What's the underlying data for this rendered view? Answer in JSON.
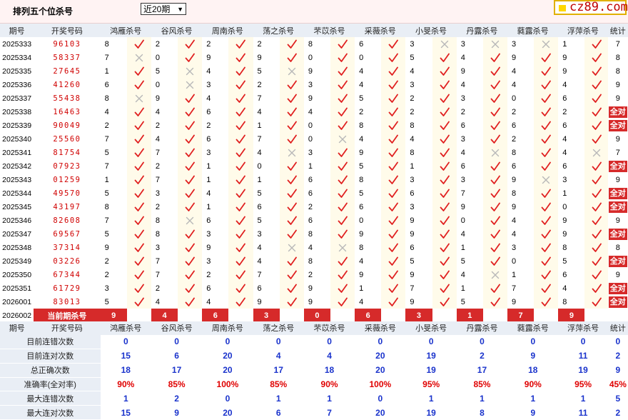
{
  "page_title": "排列五个位杀号",
  "period_select": {
    "value": "近20期"
  },
  "logo_text": "cz89.com",
  "header": {
    "period": "期号",
    "number": "开奖号码",
    "count": "统计"
  },
  "experts": [
    "鸿雁杀号",
    "谷风杀号",
    "周南杀号",
    "荡之杀号",
    "芣苡杀号",
    "采薇杀号",
    "小旻杀号",
    "丹露杀号",
    "蕤露杀号",
    "浮萍杀号"
  ],
  "all_correct_label": "全对",
  "rows": [
    {
      "period": "2025333",
      "number": "96103",
      "kills": [
        [
          8,
          1
        ],
        [
          2,
          1
        ],
        [
          2,
          1
        ],
        [
          2,
          1
        ],
        [
          8,
          1
        ],
        [
          6,
          1
        ],
        [
          3,
          0
        ],
        [
          3,
          0
        ],
        [
          3,
          0
        ],
        [
          1,
          1
        ]
      ],
      "count": "7"
    },
    {
      "period": "2025334",
      "number": "58337",
      "kills": [
        [
          7,
          0
        ],
        [
          0,
          1
        ],
        [
          9,
          1
        ],
        [
          9,
          1
        ],
        [
          0,
          1
        ],
        [
          0,
          1
        ],
        [
          5,
          1
        ],
        [
          4,
          1
        ],
        [
          9,
          1
        ],
        [
          9,
          1
        ]
      ],
      "count": "8"
    },
    {
      "period": "2025335",
      "number": "27645",
      "kills": [
        [
          1,
          1
        ],
        [
          5,
          0
        ],
        [
          4,
          1
        ],
        [
          5,
          0
        ],
        [
          9,
          1
        ],
        [
          4,
          1
        ],
        [
          4,
          1
        ],
        [
          9,
          1
        ],
        [
          4,
          1
        ],
        [
          9,
          1
        ]
      ],
      "count": "8"
    },
    {
      "period": "2025336",
      "number": "41260",
      "kills": [
        [
          6,
          1
        ],
        [
          0,
          0
        ],
        [
          3,
          1
        ],
        [
          2,
          1
        ],
        [
          3,
          1
        ],
        [
          4,
          1
        ],
        [
          3,
          1
        ],
        [
          4,
          1
        ],
        [
          4,
          1
        ],
        [
          4,
          1
        ]
      ],
      "count": "9"
    },
    {
      "period": "2025337",
      "number": "55438",
      "kills": [
        [
          8,
          0
        ],
        [
          9,
          1
        ],
        [
          4,
          1
        ],
        [
          7,
          1
        ],
        [
          9,
          1
        ],
        [
          5,
          1
        ],
        [
          2,
          1
        ],
        [
          3,
          1
        ],
        [
          0,
          1
        ],
        [
          6,
          1
        ]
      ],
      "count": "9"
    },
    {
      "period": "2025338",
      "number": "16463",
      "kills": [
        [
          4,
          1
        ],
        [
          4,
          1
        ],
        [
          6,
          1
        ],
        [
          4,
          1
        ],
        [
          4,
          1
        ],
        [
          2,
          1
        ],
        [
          2,
          1
        ],
        [
          2,
          1
        ],
        [
          2,
          1
        ],
        [
          2,
          1
        ]
      ],
      "count": "全对"
    },
    {
      "period": "2025339",
      "number": "90049",
      "kills": [
        [
          2,
          1
        ],
        [
          2,
          1
        ],
        [
          2,
          1
        ],
        [
          1,
          1
        ],
        [
          0,
          1
        ],
        [
          8,
          1
        ],
        [
          8,
          1
        ],
        [
          6,
          1
        ],
        [
          6,
          1
        ],
        [
          6,
          1
        ]
      ],
      "count": "全对"
    },
    {
      "period": "2025340",
      "number": "25560",
      "kills": [
        [
          7,
          1
        ],
        [
          4,
          1
        ],
        [
          6,
          1
        ],
        [
          7,
          1
        ],
        [
          0,
          0
        ],
        [
          4,
          1
        ],
        [
          4,
          1
        ],
        [
          3,
          1
        ],
        [
          2,
          1
        ],
        [
          4,
          1
        ]
      ],
      "count": "9"
    },
    {
      "period": "2025341",
      "number": "81754",
      "kills": [
        [
          5,
          1
        ],
        [
          7,
          1
        ],
        [
          3,
          1
        ],
        [
          4,
          0
        ],
        [
          3,
          1
        ],
        [
          9,
          1
        ],
        [
          8,
          1
        ],
        [
          4,
          0
        ],
        [
          8,
          1
        ],
        [
          4,
          0
        ]
      ],
      "count": "7"
    },
    {
      "period": "2025342",
      "number": "07923",
      "kills": [
        [
          7,
          1
        ],
        [
          2,
          1
        ],
        [
          1,
          1
        ],
        [
          0,
          1
        ],
        [
          1,
          1
        ],
        [
          5,
          1
        ],
        [
          1,
          1
        ],
        [
          6,
          1
        ],
        [
          6,
          1
        ],
        [
          6,
          1
        ]
      ],
      "count": "全对"
    },
    {
      "period": "2025343",
      "number": "01259",
      "kills": [
        [
          1,
          1
        ],
        [
          7,
          1
        ],
        [
          1,
          1
        ],
        [
          1,
          1
        ],
        [
          6,
          1
        ],
        [
          8,
          1
        ],
        [
          3,
          1
        ],
        [
          3,
          1
        ],
        [
          9,
          0
        ],
        [
          3,
          1
        ]
      ],
      "count": "9"
    },
    {
      "period": "2025344",
      "number": "49570",
      "kills": [
        [
          5,
          1
        ],
        [
          3,
          1
        ],
        [
          4,
          1
        ],
        [
          5,
          1
        ],
        [
          6,
          1
        ],
        [
          5,
          1
        ],
        [
          6,
          1
        ],
        [
          7,
          1
        ],
        [
          8,
          1
        ],
        [
          1,
          1
        ]
      ],
      "count": "全对"
    },
    {
      "period": "2025345",
      "number": "43197",
      "kills": [
        [
          8,
          1
        ],
        [
          2,
          1
        ],
        [
          1,
          1
        ],
        [
          6,
          1
        ],
        [
          2,
          1
        ],
        [
          6,
          1
        ],
        [
          3,
          1
        ],
        [
          9,
          1
        ],
        [
          9,
          1
        ],
        [
          0,
          1
        ]
      ],
      "count": "全对"
    },
    {
      "period": "2025346",
      "number": "82608",
      "kills": [
        [
          7,
          1
        ],
        [
          8,
          0
        ],
        [
          6,
          1
        ],
        [
          5,
          1
        ],
        [
          6,
          1
        ],
        [
          0,
          1
        ],
        [
          9,
          1
        ],
        [
          0,
          1
        ],
        [
          4,
          1
        ],
        [
          9,
          1
        ]
      ],
      "count": "9"
    },
    {
      "period": "2025347",
      "number": "69567",
      "kills": [
        [
          5,
          1
        ],
        [
          8,
          1
        ],
        [
          3,
          1
        ],
        [
          3,
          1
        ],
        [
          8,
          1
        ],
        [
          9,
          1
        ],
        [
          9,
          1
        ],
        [
          4,
          1
        ],
        [
          4,
          1
        ],
        [
          9,
          1
        ]
      ],
      "count": "全对"
    },
    {
      "period": "2025348",
      "number": "37314",
      "kills": [
        [
          9,
          1
        ],
        [
          3,
          1
        ],
        [
          9,
          1
        ],
        [
          4,
          0
        ],
        [
          4,
          0
        ],
        [
          8,
          1
        ],
        [
          6,
          1
        ],
        [
          1,
          1
        ],
        [
          3,
          1
        ],
        [
          8,
          1
        ]
      ],
      "count": "8"
    },
    {
      "period": "2025349",
      "number": "03226",
      "kills": [
        [
          2,
          1
        ],
        [
          7,
          1
        ],
        [
          3,
          1
        ],
        [
          4,
          1
        ],
        [
          8,
          1
        ],
        [
          4,
          1
        ],
        [
          5,
          1
        ],
        [
          5,
          1
        ],
        [
          0,
          1
        ],
        [
          5,
          1
        ]
      ],
      "count": "全对"
    },
    {
      "period": "2025350",
      "number": "67344",
      "kills": [
        [
          2,
          1
        ],
        [
          7,
          1
        ],
        [
          2,
          1
        ],
        [
          7,
          1
        ],
        [
          2,
          1
        ],
        [
          9,
          1
        ],
        [
          9,
          1
        ],
        [
          4,
          0
        ],
        [
          1,
          1
        ],
        [
          6,
          1
        ]
      ],
      "count": "9"
    },
    {
      "period": "2025351",
      "number": "61729",
      "kills": [
        [
          3,
          1
        ],
        [
          2,
          1
        ],
        [
          6,
          1
        ],
        [
          6,
          1
        ],
        [
          9,
          1
        ],
        [
          1,
          1
        ],
        [
          7,
          1
        ],
        [
          1,
          1
        ],
        [
          7,
          1
        ],
        [
          4,
          1
        ]
      ],
      "count": "全对"
    },
    {
      "period": "2026001",
      "number": "83013",
      "kills": [
        [
          5,
          1
        ],
        [
          4,
          1
        ],
        [
          4,
          1
        ],
        [
          9,
          1
        ],
        [
          9,
          1
        ],
        [
          4,
          1
        ],
        [
          9,
          1
        ],
        [
          5,
          1
        ],
        [
          9,
          1
        ],
        [
          8,
          1
        ]
      ],
      "count": "全对"
    }
  ],
  "current": {
    "period": "2026002",
    "label": "当前期杀号",
    "kills": [
      "9",
      "4",
      "6",
      "3",
      "0",
      "6",
      "3",
      "1",
      "7",
      "9"
    ]
  },
  "stats": [
    {
      "label": "目前连错次数",
      "values": [
        "0",
        "0",
        "0",
        "0",
        "0",
        "0",
        "0",
        "0",
        "0",
        "0"
      ],
      "count": "0",
      "tone": "blue"
    },
    {
      "label": "目前连对次数",
      "values": [
        "15",
        "6",
        "20",
        "4",
        "4",
        "20",
        "19",
        "2",
        "9",
        "11"
      ],
      "count": "2",
      "tone": "blue"
    },
    {
      "label": "总正确次数",
      "values": [
        "18",
        "17",
        "20",
        "17",
        "18",
        "20",
        "19",
        "17",
        "18",
        "19"
      ],
      "count": "9",
      "tone": "blue"
    },
    {
      "label": "准确率(全对率)",
      "values": [
        "90%",
        "85%",
        "100%",
        "85%",
        "90%",
        "100%",
        "95%",
        "85%",
        "90%",
        "95%"
      ],
      "count": "45%",
      "tone": "red"
    },
    {
      "label": "最大连错次数",
      "values": [
        "1",
        "2",
        "0",
        "1",
        "1",
        "0",
        "1",
        "1",
        "1",
        "1"
      ],
      "count": "5",
      "tone": "blue"
    },
    {
      "label": "最大连对次数",
      "values": [
        "15",
        "9",
        "20",
        "6",
        "7",
        "20",
        "19",
        "8",
        "9",
        "11"
      ],
      "count": "2",
      "tone": "blue"
    }
  ],
  "colors": {
    "check": "#e02020",
    "cross": "#bbbbbb",
    "highlight": "#d62a2a",
    "header_bg": "#e9eef5",
    "blue": "#1a33cc"
  }
}
